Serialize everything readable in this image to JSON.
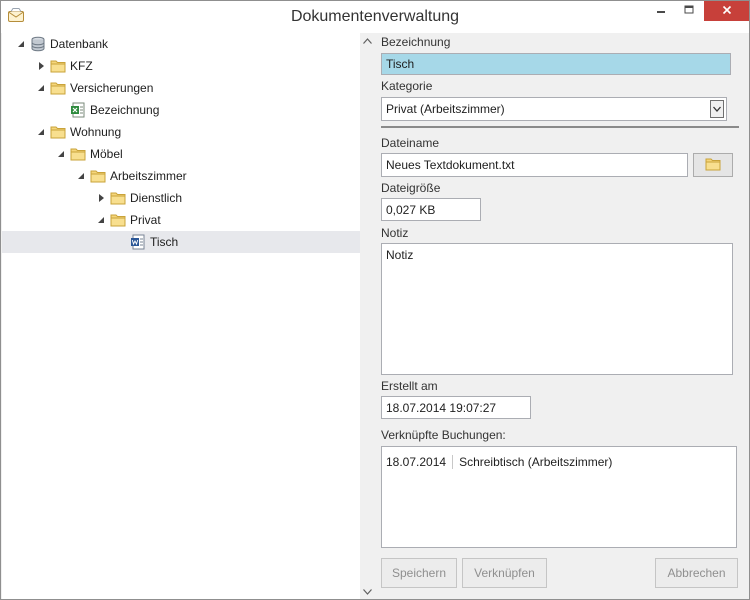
{
  "window": {
    "title": "Dokumentenverwaltung",
    "icons": {
      "app": "letter-icon",
      "minimize": "minimize-icon",
      "maximize": "maximize-icon",
      "close": "close-icon"
    },
    "colors": {
      "close_button": "#c7403a",
      "selection": "#a6d8e8",
      "tree_selected": "#e7e8ec"
    }
  },
  "tree": {
    "nodes": [
      {
        "label": "Datenbank",
        "icon": "database-icon",
        "expanded": true,
        "level": 0
      },
      {
        "label": "KFZ",
        "icon": "folder-icon",
        "expanded": false,
        "level": 1
      },
      {
        "label": "Versicherungen",
        "icon": "folder-icon",
        "expanded": true,
        "level": 1
      },
      {
        "label": "Bezeichnung",
        "icon": "spreadsheet-document-icon",
        "level": 2
      },
      {
        "label": "Wohnung",
        "icon": "folder-icon",
        "expanded": true,
        "level": 1
      },
      {
        "label": "Möbel",
        "icon": "folder-icon",
        "expanded": true,
        "level": 2
      },
      {
        "label": "Arbeitszimmer",
        "icon": "folder-icon",
        "expanded": true,
        "level": 3
      },
      {
        "label": "Dienstlich",
        "icon": "folder-icon",
        "expanded": false,
        "level": 4
      },
      {
        "label": "Privat",
        "icon": "folder-icon",
        "expanded": true,
        "level": 4
      },
      {
        "label": "Tisch",
        "icon": "word-document-icon",
        "level": 5,
        "selected": true
      }
    ]
  },
  "form": {
    "bezeichnung_label": "Bezeichnung",
    "bezeichnung_value": "Tisch",
    "kategorie_label": "Kategorie",
    "kategorie_value": "Privat (Arbeitszimmer)",
    "dateiname_label": "Dateiname",
    "dateiname_value": "Neues Textdokument.txt",
    "dateigroesse_label": "Dateigröße",
    "dateigroesse_value": "0,027 KB",
    "notiz_label": "Notiz",
    "notiz_value": "Notiz",
    "erstellt_label": "Erstellt am",
    "erstellt_value": "18.07.2014 19:07:27",
    "buchungen_label": "Verknüpfte Buchungen:",
    "buchungen": [
      {
        "date": "18.07.2014",
        "text": "Schreibtisch (Arbeitszimmer)"
      }
    ]
  },
  "buttons": {
    "speichern": "Speichern",
    "verknuepfen": "Verknüpfen",
    "abbrechen": "Abbrechen"
  }
}
